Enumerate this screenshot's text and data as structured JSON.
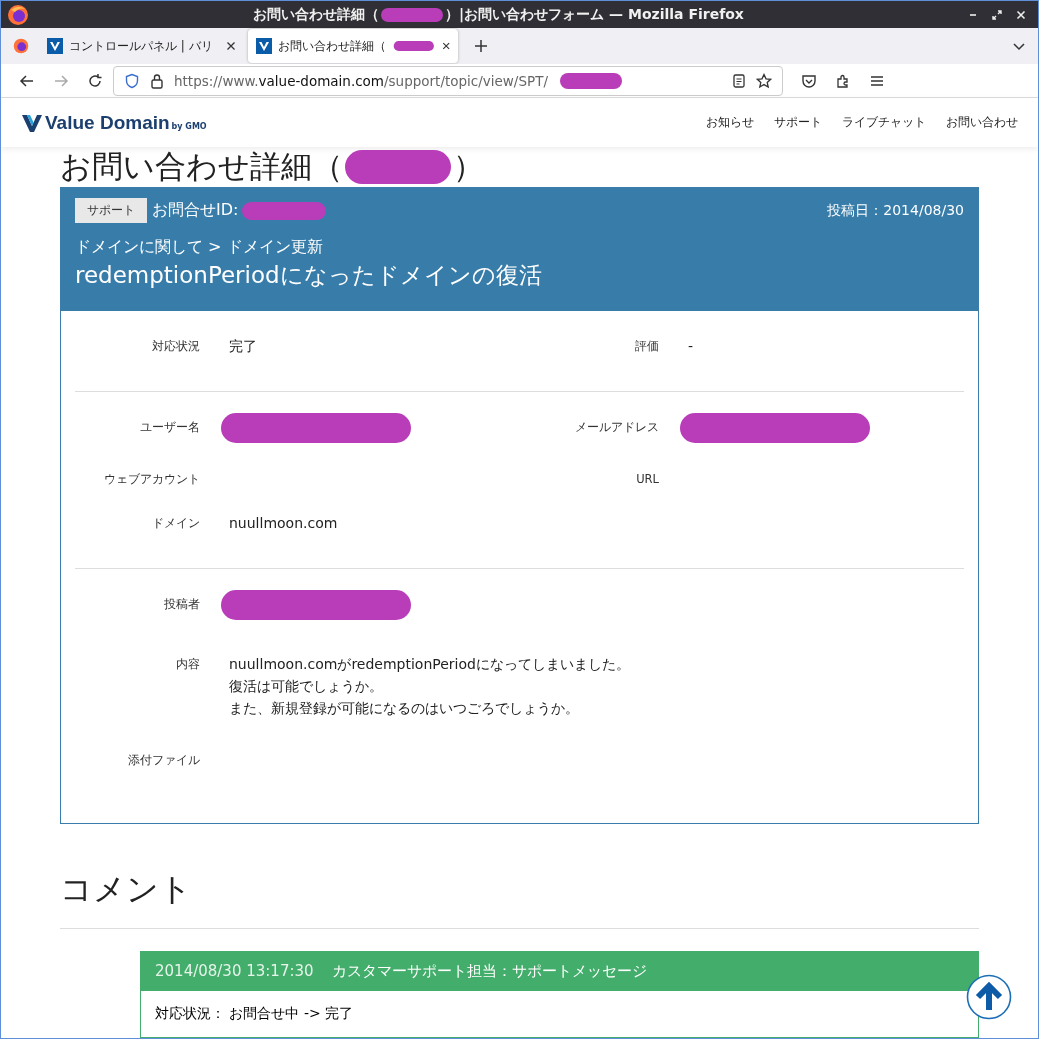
{
  "window": {
    "title_before": "お問い合わせ詳細（",
    "title_after": "）|お問い合わせフォーム — Mozilla Firefox",
    "title_redacted": true
  },
  "tabs": [
    {
      "label": "コントロールパネル | バリ",
      "selected": false,
      "redacted": false
    },
    {
      "label": "お問い合わせ詳細（",
      "selected": true,
      "redacted": true
    }
  ],
  "address_bar": {
    "scheme": "https://www.",
    "host": "value-domain.com",
    "path": "/support/topic/view/SPT/",
    "redacted": true
  },
  "site_header": {
    "logo": "Value Domain",
    "logo_sub": "by GMO",
    "nav": [
      "お知らせ",
      "サポート",
      "ライブチャット",
      "お問い合わせ"
    ]
  },
  "page_heading": {
    "before": "お問い合わせ詳細（",
    "after": "）",
    "redacted": true
  },
  "inquiry": {
    "category": "サポート",
    "id_label": "お問合せID:",
    "id_redacted": true,
    "posted": "投稿日：2014/08/30",
    "breadcrumb": "ドメインに関して > ドメイン更新",
    "title": "redemptionPeriodになったドメインの復活"
  },
  "sections": [
    {
      "kind": "two-column",
      "fields": [
        {
          "label": "対応状況",
          "value": "完了",
          "redacted": false
        },
        {
          "label": "評価",
          "value": "-",
          "redacted": false
        }
      ]
    },
    {
      "kind": "two-column",
      "fields": [
        {
          "label": "ユーザー名",
          "redacted": true
        },
        {
          "label": "メールアドレス",
          "redacted": true
        },
        {
          "label": "ウェブアカウント",
          "redacted": false
        },
        {
          "label": "URL",
          "redacted": false
        },
        {
          "label": "ドメイン",
          "value": "nuullmoon.com",
          "redacted": false
        }
      ]
    },
    {
      "kind": "one-column",
      "fields": [
        {
          "label": "投稿者",
          "redacted": true
        },
        {
          "label": "内容",
          "lines": [
            "nuullmoon.comがredemptionPeriodになってしまいました。",
            "復活は可能でしょうか。",
            "また、新規登録が可能になるのはいつごろでしょうか。"
          ],
          "redacted": false
        },
        {
          "label": "添付ファイル",
          "redacted": false
        }
      ]
    }
  ],
  "comments_heading": "コメント",
  "comments": [
    {
      "time": "2014/08/30 13:17:30",
      "author": "カスタマーサポート担当：サポートメッセージ",
      "body": "対応状況： お問合せ中 -> 完了"
    }
  ]
}
